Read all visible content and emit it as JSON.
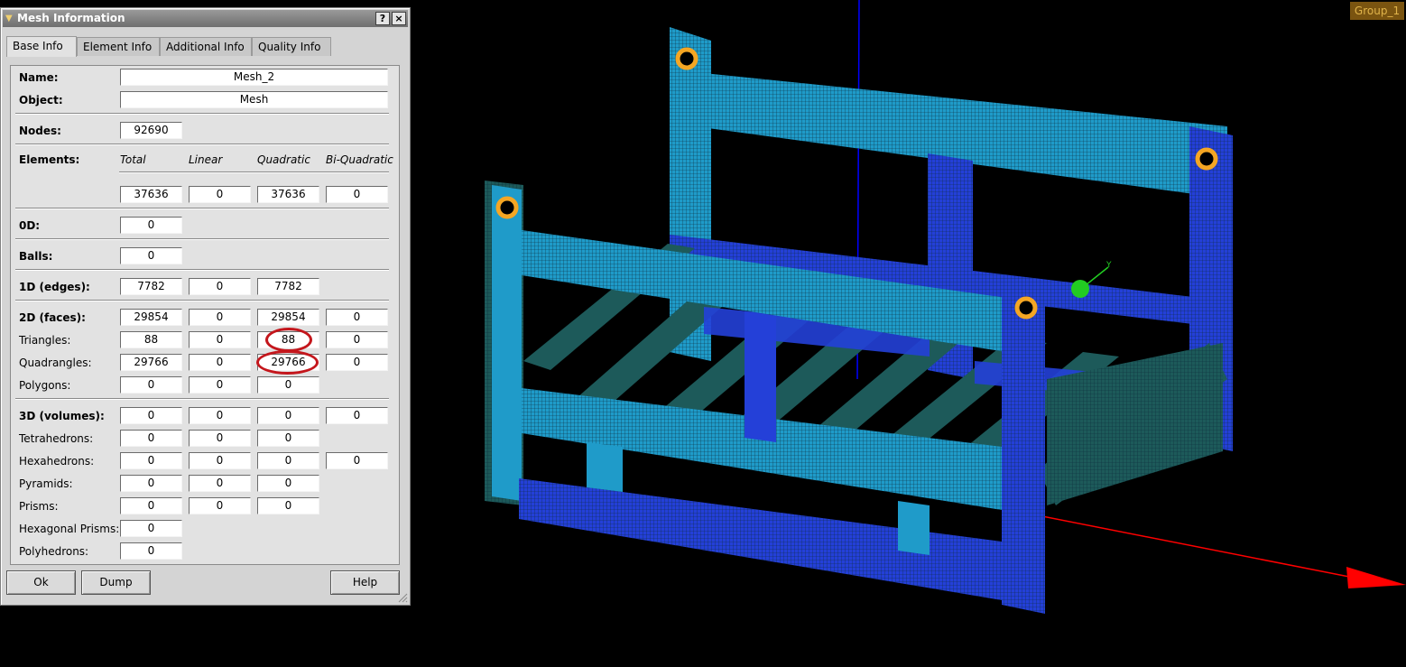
{
  "window": {
    "title": "Mesh Information",
    "help_glyph": "?",
    "close_glyph": "×"
  },
  "tabs": [
    "Base Info",
    "Element Info",
    "Additional Info",
    "Quality Info"
  ],
  "active_tab": "Base Info",
  "base_info": {
    "name_label": "Name:",
    "name_value": "Mesh_2",
    "object_label": "Object:",
    "object_value": "Mesh",
    "nodes_label": "Nodes:",
    "nodes_value": "92690",
    "elements_label": "Elements:",
    "columns": [
      "Total",
      "Linear",
      "Quadratic",
      "Bi-Quadratic"
    ],
    "elements_values": [
      "37636",
      "0",
      "37636",
      "0"
    ],
    "od_label": "0D:",
    "od_value": "0",
    "balls_label": "Balls:",
    "balls_value": "0",
    "edges_label": "1D (edges):",
    "edges_values": [
      "7782",
      "0",
      "7782"
    ],
    "faces_label": "2D (faces):",
    "faces_values": [
      "29854",
      "0",
      "29854",
      "0"
    ],
    "triangles_label": "Triangles:",
    "triangles_values": [
      "88",
      "0",
      "88",
      "0"
    ],
    "quadrangles_label": "Quadrangles:",
    "quadrangles_values": [
      "29766",
      "0",
      "29766",
      "0"
    ],
    "polygons_label": "Polygons:",
    "polygons_values": [
      "0",
      "0",
      "0"
    ],
    "volumes_label": "3D (volumes):",
    "volumes_values": [
      "0",
      "0",
      "0",
      "0"
    ],
    "tetrahedrons_label": "Tetrahedrons:",
    "tetrahedrons_values": [
      "0",
      "0",
      "0"
    ],
    "hexahedrons_label": "Hexahedrons:",
    "hexahedrons_values": [
      "0",
      "0",
      "0",
      "0"
    ],
    "pyramids_label": "Pyramids:",
    "pyramids_values": [
      "0",
      "0",
      "0"
    ],
    "prisms_label": "Prisms:",
    "prisms_values": [
      "0",
      "0",
      "0"
    ],
    "hexprisms_label": "Hexagonal Prisms:",
    "hexprisms_value": "0",
    "polyhedrons_label": "Polyhedrons:",
    "polyhedrons_value": "0"
  },
  "buttons": {
    "ok": "Ok",
    "dump": "Dump",
    "help": "Help"
  },
  "viewport": {
    "group_label": "Group_1",
    "axis_label": "Y",
    "colors": {
      "background": "#000000",
      "mesh_dark": "#1d5a5a",
      "mesh_teal": "#1f9bc9",
      "mesh_blue": "#2440d8",
      "hole_ring": "#f5a623",
      "x_axis": "#ff0000",
      "z_axis": "#0000ff",
      "y_marker": "#22cc22",
      "highlight_ring": "#c4161c"
    }
  }
}
